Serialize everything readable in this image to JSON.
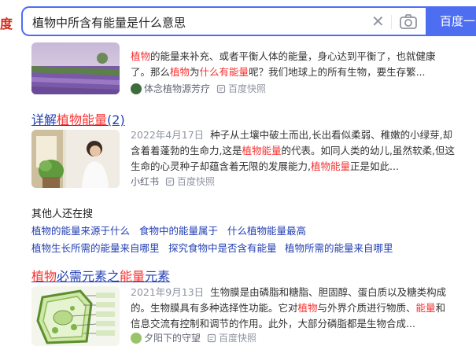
{
  "header": {
    "logo_fragment": "度",
    "search_value": "植物中所含有能量是什么意思",
    "search_button": "百度一",
    "icons": {
      "clear": "close-icon",
      "camera": "camera-icon"
    }
  },
  "results": [
    {
      "abstract_parts": [
        "植物",
        "的能量来补充、或者平衡人体的能量，身心达到平衡了，也就健康",
        "了。那么",
        "植物",
        "为",
        "什么有能量",
        "呢？我们地球上的所有生物，要生存繁..."
      ],
      "source": "体念植物源芳疗",
      "snapshot": "百度快照"
    },
    {
      "title_parts": [
        "详解",
        "植物能量",
        "(2)"
      ],
      "date": "2022年4月17日",
      "abstract_parts": [
        "种子从土壤中破土而出,长出看似柔弱、稚嫩的小绿芽,却",
        "含着着蓬勃的生命力,这是",
        "植物能量",
        "的代表。如同人类的幼儿,虽然软柔,但这",
        "生命的心灵种子却蕴含着无限的发展能力,",
        "植物能量",
        "正是如此..."
      ],
      "source": "小红书",
      "snapshot": "百度快照"
    },
    {
      "title_parts": [
        "植物",
        "必需元素之",
        "能量",
        "元素"
      ],
      "date": "2021年9月13日",
      "abstract_parts": [
        "生物膜是由磷脂和糖脂、胆固醇、蛋白质以及糖类构成",
        "的。生物膜具有多种选择性功能。它对",
        "植物",
        "与外界介质进行物质、",
        "能量",
        "和",
        "信息交流有控制和调节的作用。此外，大部分磷脂都是生物合成..."
      ],
      "source": "夕阳下的守望",
      "snapshot": "百度快照"
    }
  ],
  "related": {
    "heading": "其他人还在搜",
    "items": [
      "植物的能量来源于什么",
      "食物中的能量属于",
      "什么植物能量最高",
      "植物生长所需的能量来自哪里",
      "探究食物中是否含有能量",
      "植物所需的能量来自哪里"
    ]
  },
  "colors": {
    "accent": "#4e6ef2",
    "link": "#2440b3",
    "highlight": "#f73131",
    "muted": "#9195a3"
  }
}
